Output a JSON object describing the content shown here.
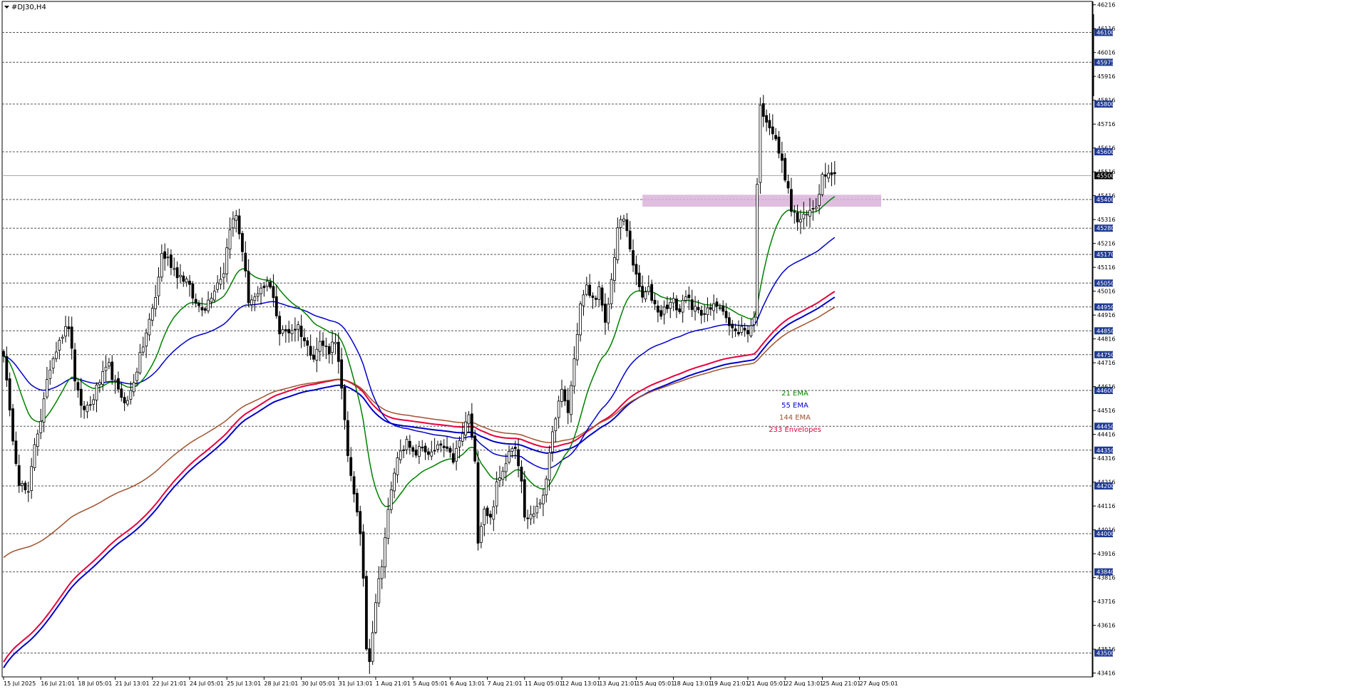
{
  "chart_data": {
    "type": "candlestick",
    "symbol_label": "#DJ30,H4",
    "ylim": [
      43400,
      46230
    ],
    "current_price": 45500,
    "y_ticks": [
      43416,
      43516,
      43616,
      43716,
      43816,
      43916,
      44016,
      44116,
      44216,
      44316,
      44416,
      44516,
      44616,
      44716,
      44816,
      44916,
      45016,
      45116,
      45216,
      45316,
      45416,
      45516,
      45616,
      45716,
      45816,
      45916,
      46016,
      46116,
      46216
    ],
    "levels": [
      46100,
      45975,
      45800,
      45600,
      45500,
      45400,
      45280,
      45170,
      45050,
      44950,
      44850,
      44750,
      44600,
      44450,
      44350,
      44200,
      44000,
      43840,
      43500
    ],
    "x_tick_labels": [
      {
        "i": 0,
        "label": "15 Jul 2025"
      },
      {
        "i": 12,
        "label": "16 Jul 21:01"
      },
      {
        "i": 24,
        "label": "18 Jul 05:01"
      },
      {
        "i": 36,
        "label": "21 Jul 13:01"
      },
      {
        "i": 48,
        "label": "22 Jul 21:01"
      },
      {
        "i": 60,
        "label": "24 Jul 05:01"
      },
      {
        "i": 72,
        "label": "25 Jul 13:01"
      },
      {
        "i": 84,
        "label": "28 Jul 21:01"
      },
      {
        "i": 96,
        "label": "30 Jul 05:01"
      },
      {
        "i": 108,
        "label": "31 Jul 13:01"
      },
      {
        "i": 120,
        "label": "1 Aug 21:01"
      },
      {
        "i": 132,
        "label": "5 Aug 05:01"
      },
      {
        "i": 144,
        "label": "6 Aug 13:01"
      },
      {
        "i": 156,
        "label": "7 Aug 21:01"
      },
      {
        "i": 168,
        "label": "11 Aug 05:01"
      },
      {
        "i": 180,
        "label": "12 Aug 13:01"
      },
      {
        "i": 192,
        "label": "13 Aug 21:01"
      },
      {
        "i": 204,
        "label": "15 Aug 05:01"
      },
      {
        "i": 216,
        "label": "18 Aug 13:01"
      },
      {
        "i": 228,
        "label": "19 Aug 21:01"
      },
      {
        "i": 240,
        "label": "21 Aug 05:01"
      },
      {
        "i": 252,
        "label": "22 Aug 13:01"
      },
      {
        "i": 264,
        "label": "25 Aug 21:01"
      },
      {
        "i": 276,
        "label": "27 Aug 05:01"
      }
    ],
    "close_anchors": [
      [
        0,
        44760
      ],
      [
        2,
        44500
      ],
      [
        5,
        44220
      ],
      [
        8,
        44160
      ],
      [
        10,
        44380
      ],
      [
        12,
        44480
      ],
      [
        15,
        44700
      ],
      [
        18,
        44820
      ],
      [
        21,
        44870
      ],
      [
        23,
        44650
      ],
      [
        25,
        44520
      ],
      [
        28,
        44540
      ],
      [
        31,
        44640
      ],
      [
        34,
        44700
      ],
      [
        37,
        44590
      ],
      [
        40,
        44550
      ],
      [
        43,
        44690
      ],
      [
        46,
        44840
      ],
      [
        49,
        44990
      ],
      [
        51,
        45170
      ],
      [
        53,
        45150
      ],
      [
        56,
        45090
      ],
      [
        59,
        45060
      ],
      [
        62,
        44960
      ],
      [
        65,
        44950
      ],
      [
        68,
        45030
      ],
      [
        71,
        45100
      ],
      [
        73,
        45290
      ],
      [
        75,
        45330
      ],
      [
        77,
        45190
      ],
      [
        79,
        44980
      ],
      [
        82,
        44990
      ],
      [
        85,
        45050
      ],
      [
        87,
        45000
      ],
      [
        89,
        44840
      ],
      [
        92,
        44850
      ],
      [
        95,
        44870
      ],
      [
        98,
        44780
      ],
      [
        100,
        44750
      ],
      [
        102,
        44800
      ],
      [
        105,
        44770
      ],
      [
        107,
        44820
      ],
      [
        109,
        44600
      ],
      [
        111,
        44320
      ],
      [
        113,
        44180
      ],
      [
        115,
        43980
      ],
      [
        116,
        43820
      ],
      [
        117,
        43520
      ],
      [
        118,
        43480
      ],
      [
        120,
        43720
      ],
      [
        122,
        43880
      ],
      [
        124,
        44090
      ],
      [
        126,
        44260
      ],
      [
        128,
        44360
      ],
      [
        130,
        44380
      ],
      [
        132,
        44330
      ],
      [
        135,
        44360
      ],
      [
        138,
        44330
      ],
      [
        141,
        44370
      ],
      [
        143,
        44340
      ],
      [
        145,
        44310
      ],
      [
        148,
        44420
      ],
      [
        150,
        44500
      ],
      [
        152,
        44290
      ],
      [
        153,
        43980
      ],
      [
        155,
        44110
      ],
      [
        157,
        44060
      ],
      [
        159,
        44200
      ],
      [
        161,
        44260
      ],
      [
        163,
        44360
      ],
      [
        165,
        44370
      ],
      [
        167,
        44230
      ],
      [
        168,
        44060
      ],
      [
        170,
        44080
      ],
      [
        172,
        44100
      ],
      [
        174,
        44170
      ],
      [
        176,
        44320
      ],
      [
        178,
        44500
      ],
      [
        180,
        44590
      ],
      [
        182,
        44510
      ],
      [
        184,
        44730
      ],
      [
        186,
        44960
      ],
      [
        188,
        45030
      ],
      [
        190,
        44980
      ],
      [
        192,
        45020
      ],
      [
        194,
        44870
      ],
      [
        196,
        45060
      ],
      [
        198,
        45280
      ],
      [
        200,
        45320
      ],
      [
        202,
        45200
      ],
      [
        204,
        45070
      ],
      [
        206,
        44990
      ],
      [
        208,
        45020
      ],
      [
        210,
        44960
      ],
      [
        212,
        44920
      ],
      [
        214,
        44960
      ],
      [
        216,
        44970
      ],
      [
        218,
        44930
      ],
      [
        220,
        45010
      ],
      [
        222,
        44930
      ],
      [
        224,
        44950
      ],
      [
        226,
        44920
      ],
      [
        228,
        44940
      ],
      [
        230,
        44960
      ],
      [
        232,
        44950
      ],
      [
        234,
        44870
      ],
      [
        236,
        44840
      ],
      [
        238,
        44860
      ],
      [
        240,
        44850
      ],
      [
        242,
        44900
      ],
      [
        243,
        45480
      ],
      [
        244,
        45780
      ],
      [
        246,
        45740
      ],
      [
        248,
        45680
      ],
      [
        250,
        45600
      ],
      [
        252,
        45500
      ],
      [
        254,
        45360
      ],
      [
        256,
        45310
      ],
      [
        258,
        45320
      ],
      [
        260,
        45350
      ],
      [
        262,
        45380
      ],
      [
        264,
        45500
      ],
      [
        266,
        45530
      ],
      [
        268,
        45500
      ]
    ],
    "indicators": [
      {
        "label": "21 EMA",
        "color": "#008000",
        "period": 21
      },
      {
        "label": "55 EMA",
        "color": "#0000cc",
        "period": 55
      },
      {
        "label": "144 EMA",
        "color": "#a0522d",
        "period": 144
      },
      {
        "label": "233 Envelopes",
        "color": "#e8003c",
        "period": 233
      }
    ],
    "colors": {
      "background": "#ffffff",
      "bull": "#ffffff",
      "bear": "#000000",
      "wick": "#000000",
      "grid": "#555555",
      "resistance_zone": "#d9b3d9",
      "axis_label_bg": "#1f3a93",
      "axis_label_text": "#ffffff"
    }
  }
}
